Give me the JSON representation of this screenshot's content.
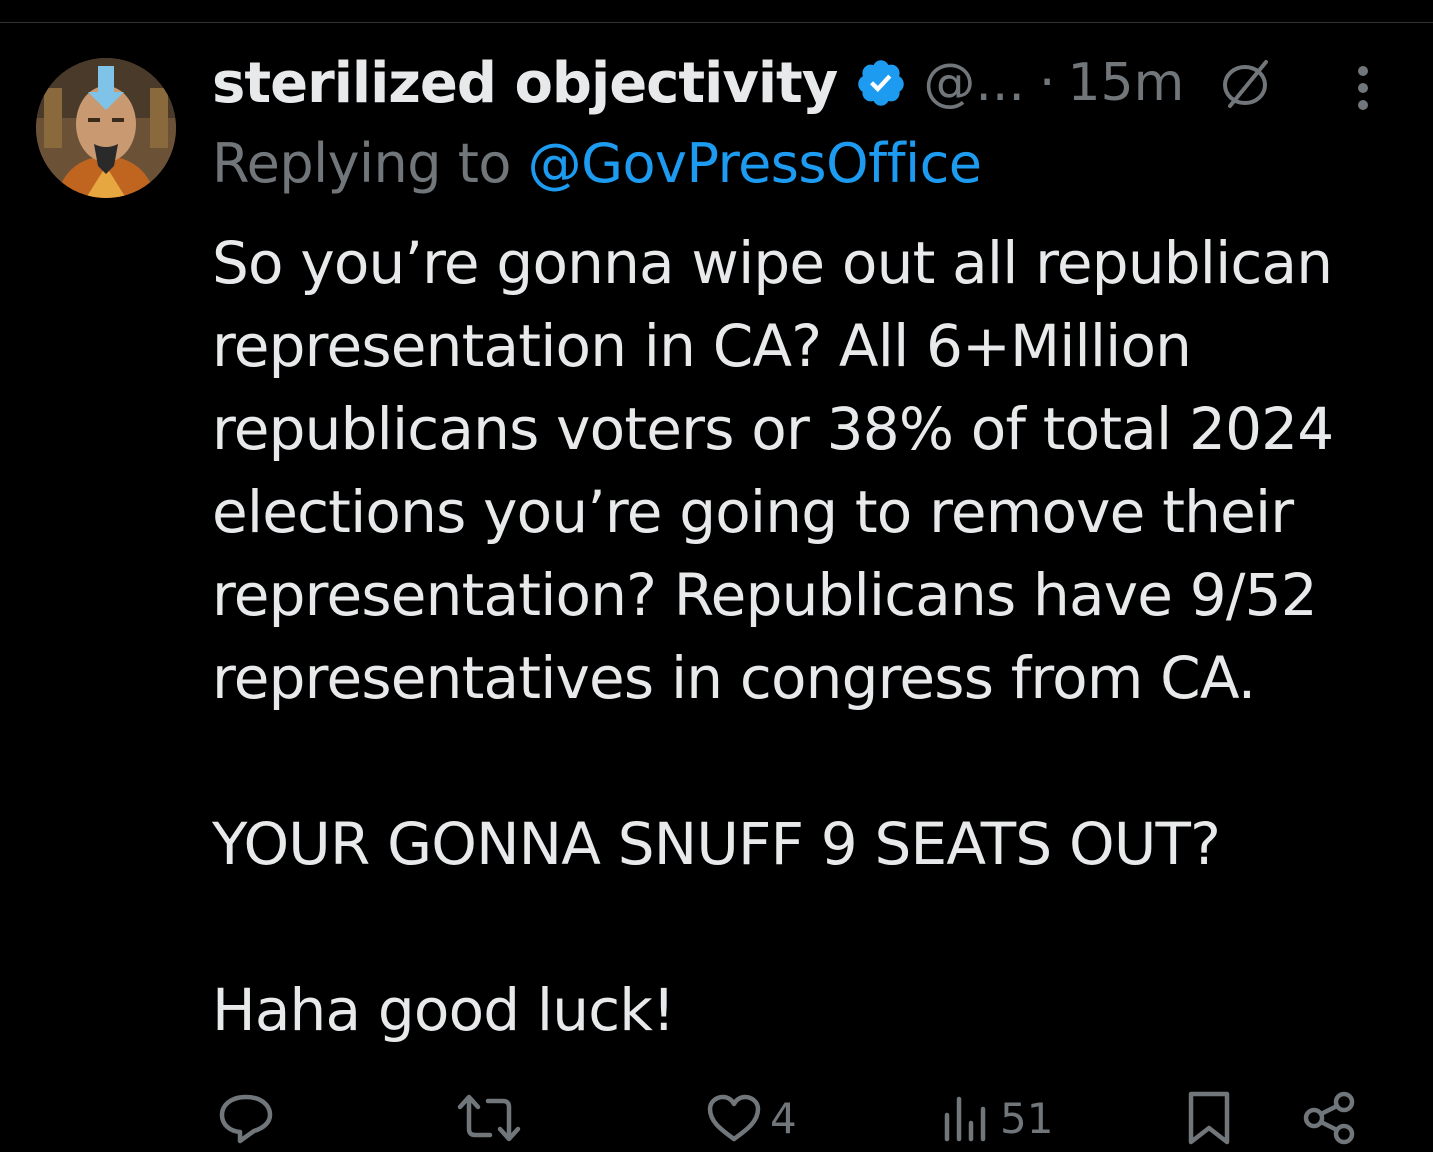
{
  "tweet": {
    "author": {
      "display_name": "sterilized objectivity",
      "handle": "@...",
      "avatar_icon": "avatar-image-icon",
      "verified": true
    },
    "separator": "·",
    "timestamp": "15m",
    "replying_prefix": "Replying to ",
    "replying_to": "@GovPressOffice",
    "text_paragraphs": [
      "So you’re gonna wipe out all republican representation in CA? All 6+Million republicans voters or 38% of total 2024 elections you’re going to remove their representation? Republicans have 9/52 representatives in congress from CA.",
      "YOUR GONNA SNUFF 9 SEATS OUT?",
      "Haha good luck!"
    ],
    "actions": {
      "reply_count": "",
      "retweet_count": "",
      "like_count": "4",
      "views_count": "51"
    }
  },
  "colors": {
    "background": "#000000",
    "text_primary": "#e7e9ea",
    "text_secondary": "#71767b",
    "link": "#1d9bf0",
    "verified_badge": "#1d9bf0"
  }
}
